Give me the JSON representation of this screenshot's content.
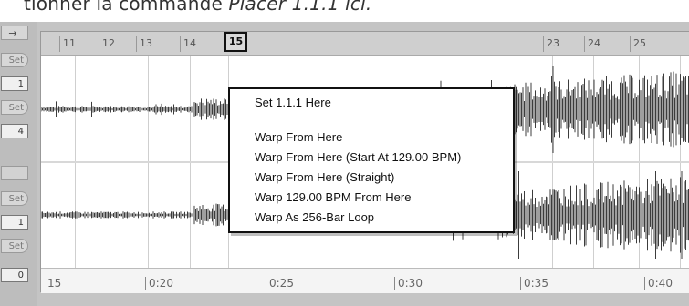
{
  "caption": {
    "text_before": "tionner la commande ",
    "command": "Placer 1.1.1 ici.",
    "text_after": ""
  },
  "left_controls": {
    "arrow": "→",
    "set_1": "Set",
    "value_1": "1",
    "set_2": "Set",
    "value_2": "4",
    "set_3": "Set",
    "value_3": "1",
    "set_4": "Set",
    "value_4": "0"
  },
  "ruler": {
    "bars": [
      "11",
      "12",
      "13",
      "14",
      "15",
      "23",
      "24",
      "25"
    ],
    "selected_marker": "15"
  },
  "timeline": {
    "labels": [
      "15",
      "0:20",
      "0:25",
      "0:30",
      "0:35",
      "0:40"
    ]
  },
  "context_menu": {
    "items": [
      "Set 1.1.1 Here",
      "Warp From Here",
      "Warp From Here (Start At 129.00 BPM)",
      "Warp From Here (Straight)",
      "Warp 129.00 BPM From Here",
      "Warp As 256-Bar Loop"
    ]
  },
  "colors": {
    "waveform": "#3c3c3c",
    "panel": "#c4c4c4",
    "ruler": "#cfcfcf",
    "menu_border": "#111111"
  }
}
